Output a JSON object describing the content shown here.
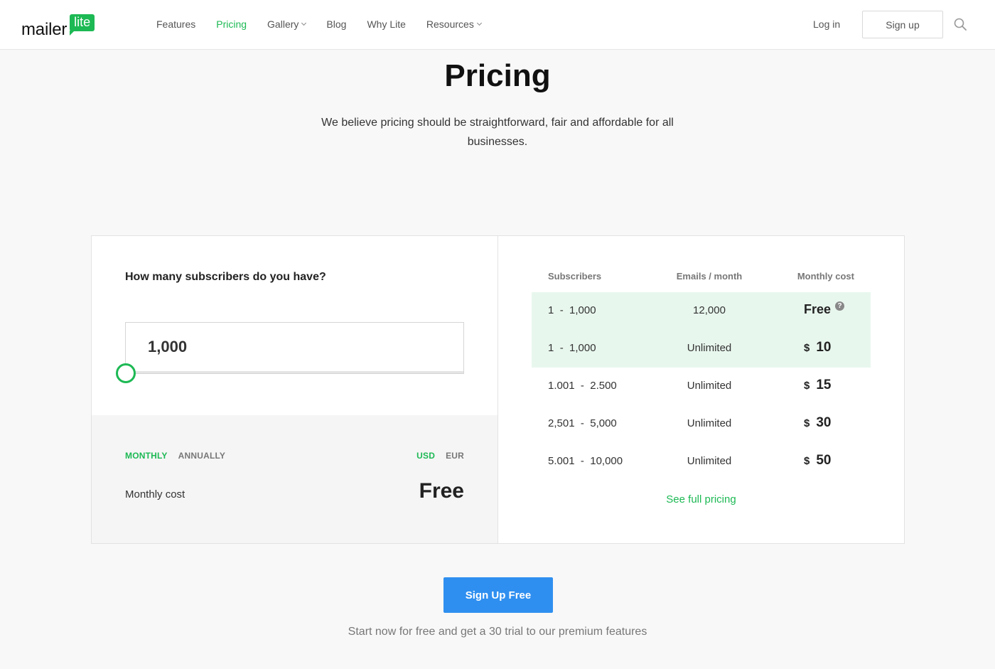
{
  "header": {
    "logo_word": "mailer",
    "logo_badge": "lite",
    "nav": [
      {
        "label": "Features"
      },
      {
        "label": "Pricing"
      },
      {
        "label": "Gallery"
      },
      {
        "label": "Blog"
      },
      {
        "label": "Why Lite"
      },
      {
        "label": "Resources"
      }
    ],
    "login_label": "Log in",
    "signup_label": "Sign up"
  },
  "hero": {
    "title": "Pricing",
    "subtitle": "We believe pricing should be straightforward, fair and affordable for all businesses."
  },
  "calculator": {
    "question": "How many subscribers do you have?",
    "subscribers_value": "1,000",
    "billing": {
      "monthly": "MONTHLY",
      "annually": "ANNUALLY"
    },
    "currency": {
      "usd": "USD",
      "eur": "EUR"
    },
    "monthly_cost_label": "Monthly cost",
    "monthly_cost_value": "Free"
  },
  "table": {
    "headers": {
      "subscribers": "Subscribers",
      "emails": "Emails / month",
      "cost": "Monthly cost"
    },
    "rows": [
      {
        "from": "1",
        "to": "1,000",
        "emails": "12,000",
        "cost": "Free"
      },
      {
        "from": "1",
        "to": "1,000",
        "emails": "Unlimited",
        "currency": "$",
        "cost": "10"
      },
      {
        "from": "1.001",
        "to": "2.500",
        "emails": "Unlimited",
        "currency": "$",
        "cost": "15"
      },
      {
        "from": "2,501",
        "to": "5,000",
        "emails": "Unlimited",
        "currency": "$",
        "cost": "30"
      },
      {
        "from": "5.001",
        "to": "10,000",
        "emails": "Unlimited",
        "currency": "$",
        "cost": "50"
      }
    ],
    "range_separator": "-",
    "help_glyph": "?",
    "see_full_label": "See full pricing"
  },
  "cta": {
    "button_label": "Sign Up Free",
    "note": "Start now for free and get a 30 trial to our premium features"
  },
  "colors": {
    "accent_green": "#1db954",
    "highlight_row": "#e8f7ee",
    "cta_blue": "#2f8ff0"
  }
}
